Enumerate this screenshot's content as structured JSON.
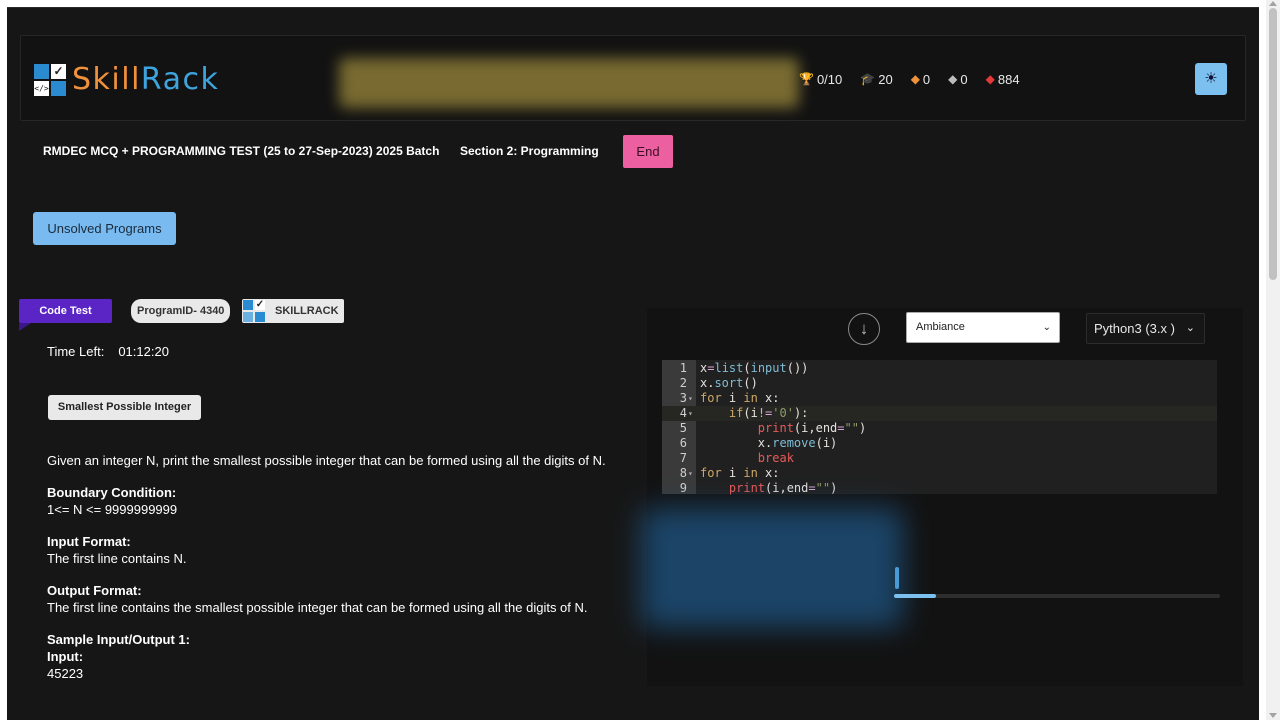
{
  "brand": {
    "part1": "Skill",
    "part2": "Rack",
    "mark_top_right": "✓",
    "mark_bottom_left": "</>"
  },
  "stats": [
    {
      "icon": "trophy-icon",
      "glyph": "🏆",
      "value": "0/10"
    },
    {
      "icon": "graduation-cap-icon",
      "glyph": "🎓",
      "value": "20"
    },
    {
      "icon": "gold-gem-icon",
      "glyph": "◆",
      "value": "0"
    },
    {
      "icon": "silver-gem-icon",
      "glyph": "◆",
      "value": "0"
    },
    {
      "icon": "red-gem-icon",
      "glyph": "◆",
      "value": "884"
    }
  ],
  "test": {
    "title": "RMDEC MCQ + PROGRAMMING TEST (25 to 27-Sep-2023) 2025 Batch",
    "section": "Section 2: Programming",
    "end_label": "End"
  },
  "unsolved_label": "Unsolved Programs",
  "tags": {
    "code_test": "Code Test",
    "program_id": "ProgramID- 4340",
    "skillrack": "SKILLRACK"
  },
  "time": {
    "label": "Time Left:",
    "value": "01:12:20"
  },
  "problem": {
    "title": "Smallest Possible Integer",
    "description": "Given an integer N, print the smallest possible integer that can be formed using all the digits of N.",
    "boundary_heading": "Boundary Condition:",
    "boundary_text": "1<= N <= 9999999999",
    "input_heading": "Input Format:",
    "input_text": "The first line contains N.",
    "output_heading": "Output Format:",
    "output_text": "The first line contains the smallest possible integer that can be formed using all the digits of N.",
    "sample_heading": "Sample Input/Output 1:",
    "sample_input_heading": "Input:",
    "sample_input": "45223"
  },
  "editor": {
    "theme_selected": "Ambiance",
    "language_selected": "Python3 (3.x )",
    "download_icon": "arrow-down-circle-icon",
    "line_numbers": [
      "1",
      "2",
      "3",
      "4",
      "5",
      "6",
      "7",
      "8",
      "9"
    ],
    "progress_fraction": 0.13
  },
  "colors": {
    "background": "#161616",
    "accent_blue": "#79baf0",
    "end_pink": "#ec5fa0",
    "code_test_purple": "#5b25c6",
    "brand_orange": "#f0913c",
    "brand_blue": "#3ea4dd"
  }
}
